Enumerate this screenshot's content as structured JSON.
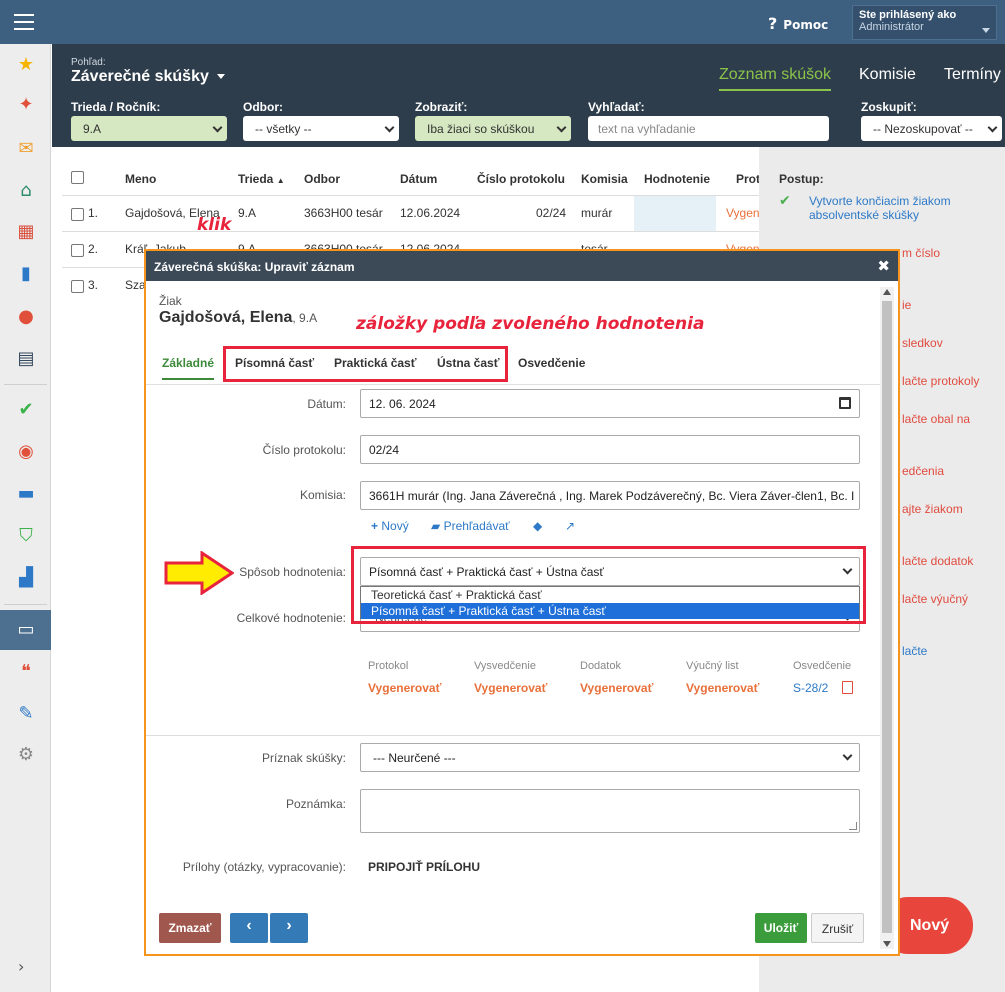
{
  "topbar": {
    "help_label": "Pomoc",
    "user_line1": "Ste prihlásený ako",
    "user_line2": "Administrátor"
  },
  "sidebar": {
    "icons": [
      "star-icon",
      "magic-wand-icon",
      "envelope-icon",
      "home-icon",
      "grid-icon",
      "book-icon",
      "user-icon",
      "calendar-icon",
      "check-circle-icon",
      "a-plus-icon",
      "briefcase-icon",
      "shield-icon",
      "bar-chart-icon",
      "open-book-icon",
      "chat-icon",
      "pencil-icon",
      "gear-icon",
      "chevron-right-icon"
    ]
  },
  "header": {
    "view_label": "Pohľad:",
    "view_title": "Záverečné skúšky",
    "tabs": [
      {
        "label": "Zoznam skúšok",
        "active": true
      },
      {
        "label": "Komisie",
        "active": false
      },
      {
        "label": "Termíny",
        "active": false
      }
    ],
    "filters": [
      {
        "label": "Trieda / Ročník:",
        "value": "9.A"
      },
      {
        "label": "Odbor:",
        "value": "-- všetky --"
      },
      {
        "label": "Zobraziť:",
        "value": "Iba žiaci so skúškou"
      },
      {
        "label": "Vyhľadať:",
        "placeholder": "text na vyhľadanie"
      },
      {
        "label": "Zoskupiť:",
        "value": "-- Nezoskupovať --"
      }
    ]
  },
  "table": {
    "columns": [
      "Meno",
      "Trieda",
      "Odbor",
      "Dátum",
      "Číslo protokolu",
      "Komisia",
      "Hodnotenie",
      "Prot"
    ],
    "sort_indicator": "▲",
    "rows": [
      {
        "num": "1.",
        "name": "Gajdošová, Elena",
        "class": "9.A",
        "odbor": "3663H00 tesár",
        "date": "12.06.2024",
        "protocol": "02/24",
        "commission": "murár",
        "prot": "Vygen"
      },
      {
        "num": "2.",
        "name": "Kráľ, Jakub",
        "class": "9.A",
        "odbor": "3663H00 tesár",
        "date": "12.06.2024",
        "protocol": "",
        "commission": "tesár",
        "prot": "Vygen"
      },
      {
        "num": "3.",
        "name": "Sza",
        "class": "",
        "odbor": "",
        "date": "",
        "protocol": "",
        "commission": "",
        "prot": ""
      }
    ]
  },
  "annotations": {
    "klik": "klik",
    "tabs_note": "záložky podľa zvoleného hodnotenia"
  },
  "right_panel": {
    "postup_label": "Postup:",
    "step1": "Vytvorte končiacim žiakom absolventské skúšky",
    "items": [
      "m číslo",
      "ie",
      "sledkov",
      "lačte protokoly",
      "lačte obal na",
      "edčenia",
      "ajte žiakom",
      "lačte dodatok",
      "lačte výučný",
      "lačte"
    ],
    "new_button": "Nový"
  },
  "modal": {
    "title": "Záverečná skúška: Upraviť záznam",
    "ziak_label": "Žiak",
    "ziak_name": "Gajdošová, Elena",
    "ziak_class": ", 9.A",
    "tabs": [
      "Základné",
      "Písomná časť",
      "Praktická časť",
      "Ústna časť",
      "Osvedčenie"
    ],
    "fields": {
      "datum_label": "Dátum:",
      "datum_value": "12. 06. 2024",
      "protokol_label": "Číslo protokolu:",
      "protokol_value": "02/24",
      "komisia_label": "Komisia:",
      "komisia_value": "3661H murár (Ing. Jana Záverečná , Ing. Marek Podzáverečný, Bc. Viera Záver-člen1, Bc. I",
      "komisia_links": {
        "new": "Nový",
        "browse": "Prehľadávať"
      },
      "sposob_label": "Spôsob hodnotenia:",
      "sposob_value": "Písomná časť + Praktická časť + Ústna časť",
      "sposob_options": [
        "Teoretická časť + Praktická časť",
        "Písomná časť + Praktická časť + Ústna časť"
      ],
      "celkove_label": "Celkové hodnotenie:",
      "celkove_value": "Neurčené",
      "priznak_label": "Príznak skúšky:",
      "priznak_value": "--- Neurčené ---",
      "poznamka_label": "Poznámka:",
      "prilohy_label": "Prílohy (otázky, vypracovanie):",
      "prilohy_value": "PRIPOJIŤ PRÍLOHU"
    },
    "documents": [
      {
        "label": "Protokol",
        "value": "Vygenerovať"
      },
      {
        "label": "Vysvedčenie",
        "value": "Vygenerovať"
      },
      {
        "label": "Dodatok",
        "value": "Vygenerovať"
      },
      {
        "label": "Výučný list",
        "value": "Vygenerovať"
      },
      {
        "label": "Osvedčenie",
        "value": "S-28/2"
      }
    ],
    "buttons": {
      "delete": "Zmazať",
      "prev": "‹",
      "next": "›",
      "save": "Uložiť",
      "cancel": "Zrušiť"
    }
  },
  "colors": {
    "topbar": "#3d5f80",
    "header": "#2e3d4b",
    "accent_green": "#8bc34a",
    "highlight_red": "#e8233c",
    "modal_border": "#f7941d"
  }
}
